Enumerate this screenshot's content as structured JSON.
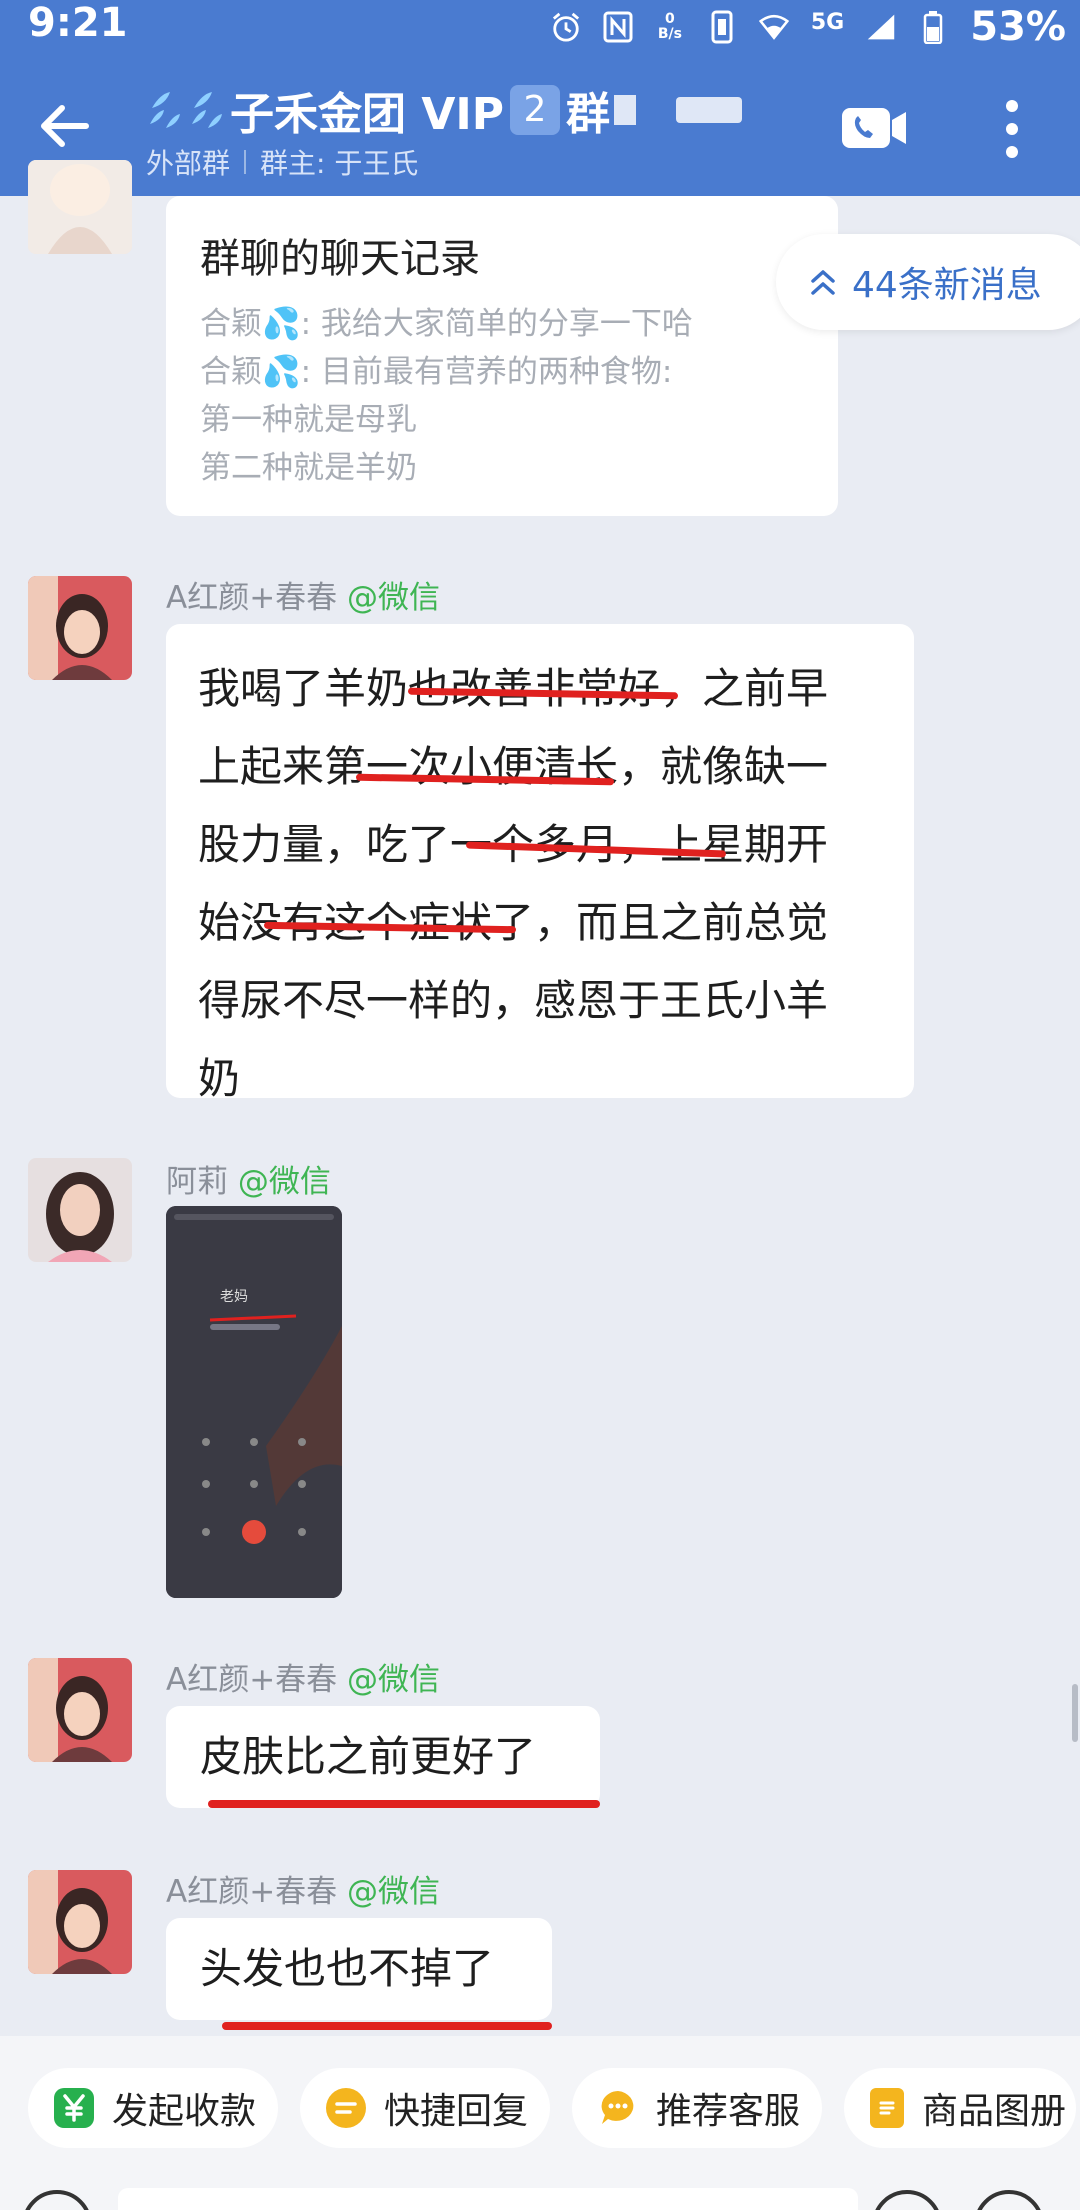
{
  "status_bar": {
    "time": "9:21",
    "net_speed_top": "0",
    "net_speed_bottom": "B/s",
    "network": "5G",
    "battery": "53%"
  },
  "header": {
    "title": "子禾金团 VIP",
    "badge": "2",
    "title_suffix": "群",
    "subtitle_left": "外部群",
    "subtitle_right": "群主: 于王氏",
    "icons": [
      "back-arrow-icon",
      "water-drop-icon",
      "video-call-icon",
      "more-vertical-icon"
    ]
  },
  "new_messages": {
    "label": "44条新消息",
    "icon": "double-chevron-up-icon",
    "color": "#3a70c8"
  },
  "messages": [
    {
      "type": "chat_record",
      "title": "群聊的聊天记录",
      "lines": [
        "合颖💦: 我给大家简单的分享一下哈",
        "合颖💦: 目前最有营养的两种食物:",
        "第一种就是母乳",
        "第二种就是羊奶"
      ]
    },
    {
      "type": "text",
      "sender": "A红颜+春春",
      "source": "@微信",
      "lines": [
        "我喝了羊奶也改善非常好，之前早",
        "上起来第一次小便清长，就像缺一",
        "股力量，吃了一个多月，上星期开",
        "始没有这个症状了，而且之前总觉",
        "得尿不尽一样的，感恩于王氏小羊",
        "奶"
      ]
    },
    {
      "type": "image",
      "sender": "阿莉",
      "source": "@微信",
      "image_caption": "老妈"
    },
    {
      "type": "text",
      "sender": "A红颜+春春",
      "source": "@微信",
      "lines": [
        "皮肤比之前更好了"
      ]
    },
    {
      "type": "text",
      "sender": "A红颜+春春",
      "source": "@微信",
      "lines": [
        "头发也也不掉了"
      ]
    }
  ],
  "toolbar": {
    "buttons": [
      {
        "label": "发起收款",
        "icon": "yen-icon",
        "color": "#27b04e"
      },
      {
        "label": "快捷回复",
        "icon": "quick-reply-icon",
        "color": "#f4b51e"
      },
      {
        "label": "推荐客服",
        "icon": "chat-bubble-icon",
        "color": "#f4b51e"
      },
      {
        "label": "商品图册",
        "icon": "catalog-icon",
        "color": "#f4b51e"
      }
    ]
  },
  "colors": {
    "header": "#4a7bd0",
    "background": "#e9ecf3",
    "wechat_green": "#3fb553",
    "annotation_red": "#e0211f"
  }
}
